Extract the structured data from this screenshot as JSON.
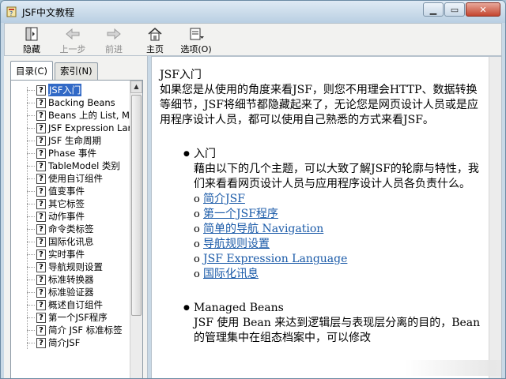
{
  "window": {
    "title": "JSF中文教程"
  },
  "toolbar": {
    "items": [
      {
        "label": "隐藏",
        "icon": "hide-icon",
        "enabled": true
      },
      {
        "label": "上一步",
        "icon": "back-arrow-icon",
        "enabled": false
      },
      {
        "label": "前进",
        "icon": "forward-arrow-icon",
        "enabled": false
      },
      {
        "label": "主页",
        "icon": "home-icon",
        "enabled": true
      },
      {
        "label": "选项(O)",
        "icon": "options-icon",
        "enabled": true
      }
    ]
  },
  "tabs": [
    {
      "label": "目录(C)",
      "active": true
    },
    {
      "label": "索引(N)",
      "active": false
    }
  ],
  "tree": {
    "items": [
      "JSF入门",
      "Backing Beans",
      "Beans 上的 List, M",
      "JSF Expression Lar",
      "JSF 生命周期",
      "Phase 事件",
      "TableModel 类别",
      "使用自订组件",
      "值变事件",
      "其它标签",
      "动作事件",
      "命令类标签",
      "国际化讯息",
      "实时事件",
      "导航规则设置",
      "标准转换器",
      "标准验证器",
      "概述自订组件",
      "第一个JSF程序",
      "简介 JSF 标准标签",
      "简介JSF"
    ],
    "selected": 0
  },
  "content": {
    "title": "JSF入门",
    "intro": "如果您是从使用的角度来看JSF，则您不用理会HTTP、数据转换等细节，JSF将细节都隐藏起来了，无论您是网页设计人员或是应用程序设计人员，都可以使用自己熟悉的方式来看JSF。",
    "section1": {
      "heading": "入门",
      "body": "藉由以下的几个主题，可以大致了解JSF的轮廓与特性，我们来看看网页设计人员与应用程序设计人员各负责什么。",
      "links": [
        "简介JSF",
        "第一个JSF程序",
        "简单的导航 Navigation",
        "导航规则设置",
        "JSF Expression Language",
        "国际化讯息"
      ]
    },
    "section2": {
      "heading": "Managed Beans",
      "body": "JSF 使用 Bean 来达到逻辑层与表现层分离的目的，Bean的管理集中在组态档案中，可以修改"
    }
  }
}
